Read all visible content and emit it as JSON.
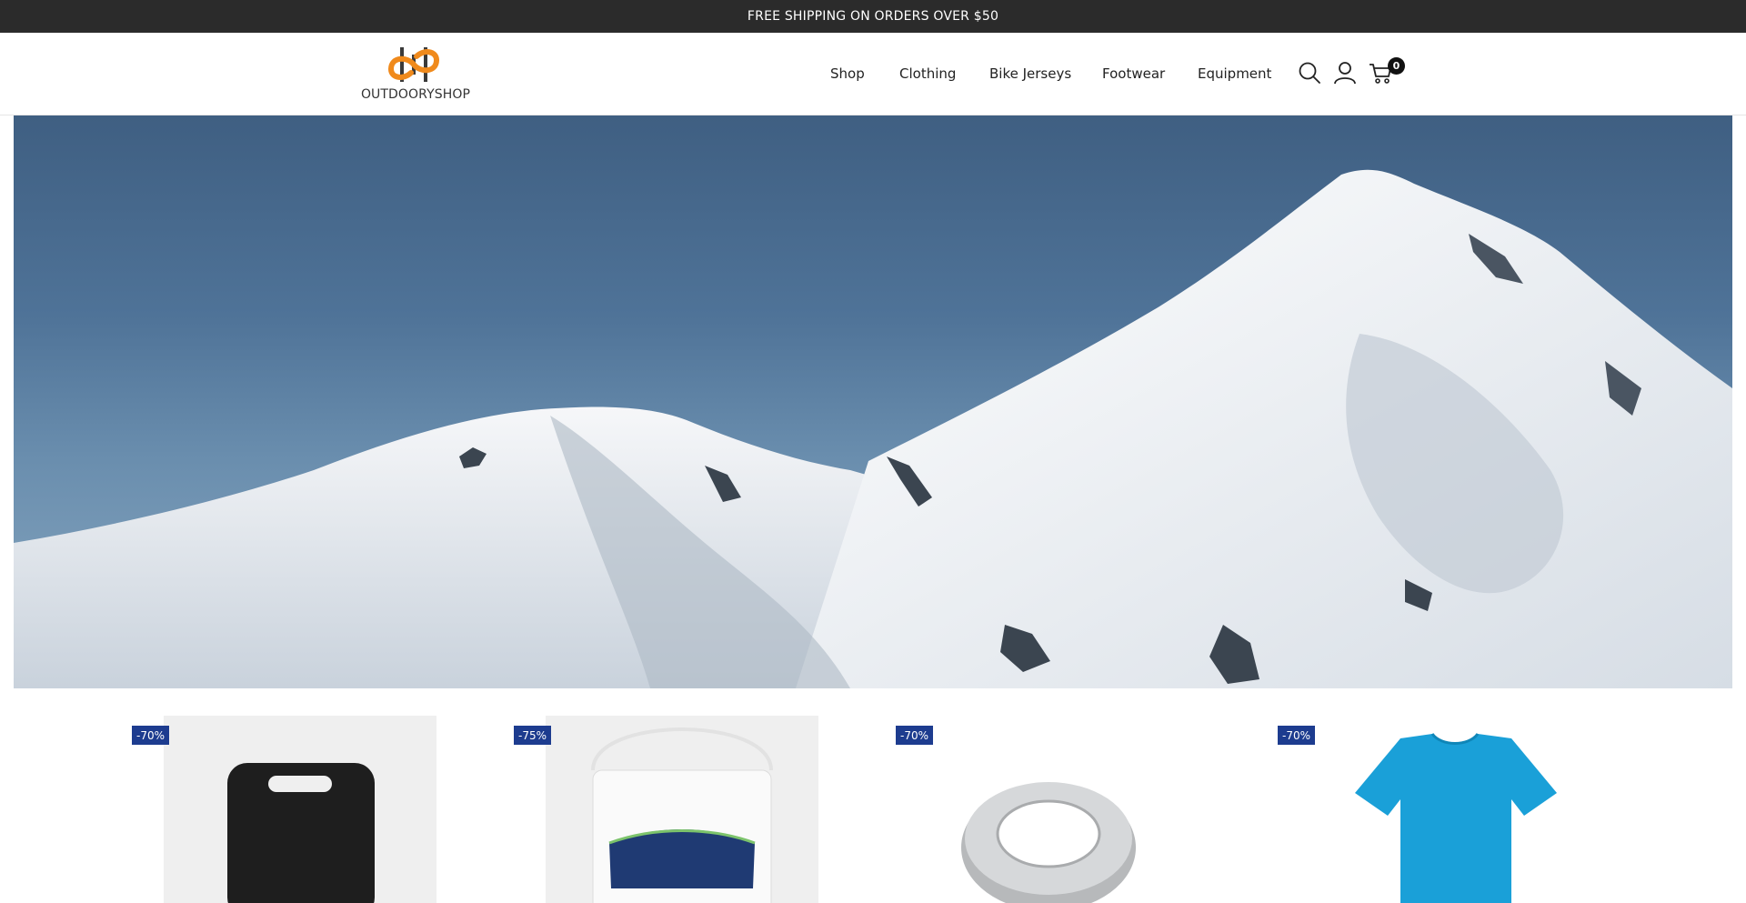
{
  "announcement": {
    "text": "FREE SHIPPING ON ORDERS OVER $50"
  },
  "header": {
    "logo_text": "OUTDOORYSHOP",
    "nav": {
      "shop": "Shop",
      "clothing": "Clothing",
      "bike_jerseys": "Bike Jerseys",
      "footwear": "Footwear",
      "equipment": "Equipment"
    },
    "icons": {
      "search": "search-icon",
      "account": "user-icon",
      "cart": "cart-icon"
    },
    "cart_count": "0"
  },
  "hero": {
    "image": "snowy-mountain-peaks-under-blue-sky"
  },
  "products": [
    {
      "discount": "-70%",
      "image": "black-cutting-board"
    },
    {
      "discount": "-75%",
      "image": "white-supplement-bucket"
    },
    {
      "discount": "-70%",
      "image": "aluminum-ring-adapter"
    },
    {
      "discount": "-70%",
      "image": "blue-tshirt"
    }
  ],
  "colors": {
    "announcement_bg": "#2b2b2b",
    "badge_bg": "#1d3c8f",
    "logo_orange": "#f08a1c",
    "logo_dark": "#3a3a3a"
  }
}
